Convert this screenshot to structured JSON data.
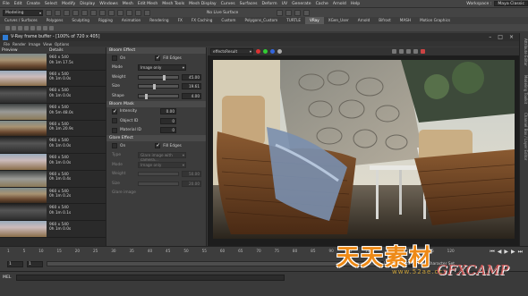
{
  "menubar": {
    "items": [
      "File",
      "Edit",
      "Create",
      "Select",
      "Modify",
      "Display",
      "Windows",
      "Mesh",
      "Edit Mesh",
      "Mesh Tools",
      "Mesh Display",
      "Curves",
      "Surfaces",
      "Deform",
      "UV",
      "Generate",
      "Cache",
      "Arnold",
      "Help"
    ],
    "workspace_label": "Workspace :",
    "workspace_value": "Maya Classic"
  },
  "statusline": {
    "mode": "Modeling",
    "no_live": "No Live Surface"
  },
  "shelf": {
    "tabs": [
      "Curves / Surfaces",
      "Polygons",
      "Sculpting",
      "Rigging",
      "Animation",
      "Rendering",
      "FX",
      "FX Caching",
      "Custom",
      "Polygons_Custom",
      "TURTLE",
      "VRay",
      "XGen_User",
      "Arnold",
      "Bifrost",
      "MASH",
      "Motion Graphics"
    ],
    "active": "VRay"
  },
  "vfb": {
    "title": "V-Ray frame buffer - [100% of 720 x 405]",
    "menu": [
      "File",
      "Render",
      "Image",
      "View",
      "Options"
    ]
  },
  "history": {
    "col_preview": "Preview",
    "col_details": "Details",
    "rows": [
      {
        "res": "960 x 540",
        "time": "0h 1m 17.5s"
      },
      {
        "res": "960 x 540",
        "time": "0h 1m 0.0s"
      },
      {
        "res": "960 x 540",
        "time": "0h 1m 0.0s"
      },
      {
        "res": "960 x 540",
        "time": "0h 5m 48.0s"
      },
      {
        "res": "960 x 540",
        "time": "0h 1m 20.9s"
      },
      {
        "res": "960 x 540",
        "time": "0h 1m 0.0s"
      },
      {
        "res": "960 x 540",
        "time": "0h 1m 0.0s"
      },
      {
        "res": "960 x 540",
        "time": "0h 1m 0.4s"
      },
      {
        "res": "960 x 540",
        "time": "0h 1m 0.2s"
      },
      {
        "res": "960 x 540",
        "time": "0h 1m 0.1s"
      },
      {
        "res": "960 x 540",
        "time": "0h 1m 0.0s"
      }
    ]
  },
  "bloom": {
    "header": "Bloom Effect",
    "on_label": "On",
    "fill_edges_label": "Fill Edges",
    "mode_label": "Mode",
    "mode_value": "Image only",
    "weight_label": "Weight",
    "weight_value": "45.00",
    "size_label": "Size",
    "size_value": "19.61",
    "shape_label": "Shape",
    "shape_value": "4.00",
    "mask_header": "Bloom Mask",
    "intensity_label": "Intensity",
    "intensity_value": "0.00",
    "object_id_label": "Object ID",
    "object_id_value": "0",
    "material_id_label": "Material ID",
    "material_id_value": "0",
    "weight_slider": 0.65,
    "size_slider": 0.4,
    "shape_slider": 0.2
  },
  "glare": {
    "header": "Glare Effect",
    "on_label": "On",
    "fill_edges_label": "Fill Edges",
    "type_label": "Type",
    "type_value": "Glare image with camera...",
    "mode_label": "Mode",
    "mode_value": "Image only",
    "weight_label": "Weight",
    "weight_value": "50.00",
    "size_label": "Size",
    "size_value": "20.00",
    "image_header": "Glare image"
  },
  "viewer": {
    "channel": "effectsResult"
  },
  "timeline": {
    "ticks": [
      "1",
      "5",
      "10",
      "15",
      "20",
      "25",
      "30",
      "35",
      "40",
      "45",
      "50",
      "55",
      "60",
      "65",
      "70",
      "75",
      "80",
      "85",
      "90",
      "95",
      "100",
      "105",
      "110",
      "115",
      "120"
    ],
    "start": "1",
    "end": "120",
    "range_start": "1",
    "range_end": "120",
    "character_set": "No Character Set"
  },
  "cmdline": {
    "label": "MEL"
  },
  "watermark": {
    "main": "天天素材",
    "site": "www.52ae.cc",
    "brand": "GFXCAMP"
  },
  "colors": {
    "accent": "#3d5a7a",
    "watermark": "#ee8a17"
  }
}
